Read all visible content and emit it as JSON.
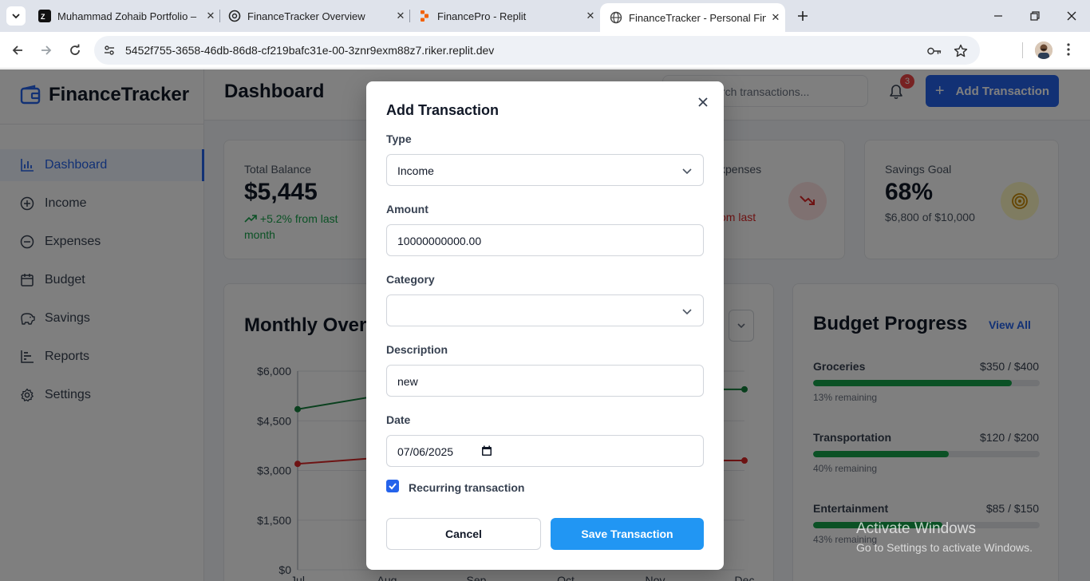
{
  "browser": {
    "tabs": [
      {
        "title": "Muhammad Zohaib Portfolio –",
        "favicon": "zohaib-logo-icon"
      },
      {
        "title": "FinanceTracker Overview",
        "favicon": "openai-icon"
      },
      {
        "title": "FinancePro - Replit",
        "favicon": "replit-icon"
      },
      {
        "title": "FinanceTracker - Personal Finan",
        "favicon": "globe-icon"
      }
    ],
    "url": "5452f755-3658-46db-86d8-cf219bafc31e-00-3znr9exm88z7.riker.replit.dev"
  },
  "app": {
    "name": "FinanceTracker",
    "page_title": "Dashboard",
    "search_placeholder": "Search transactions...",
    "notification_count": "3",
    "add_transaction_label": "Add Transaction",
    "nav": [
      {
        "label": "Dashboard",
        "icon": "bar-chart-icon"
      },
      {
        "label": "Income",
        "icon": "plus-circle-icon"
      },
      {
        "label": "Expenses",
        "icon": "minus-circle-icon"
      },
      {
        "label": "Budget",
        "icon": "calendar-icon"
      },
      {
        "label": "Savings",
        "icon": "piggy-bank-icon"
      },
      {
        "label": "Reports",
        "icon": "chart-icon"
      },
      {
        "label": "Settings",
        "icon": "gear-icon"
      }
    ],
    "stats": {
      "balance": {
        "label": "Total Balance",
        "value": "$5,445",
        "sub": "+5.2% from last month"
      },
      "expenses": {
        "label": "xpenses",
        "sub": "om last"
      },
      "savings": {
        "label": "Savings Goal",
        "value": "68%",
        "sub": "$6,800 of $10,000"
      }
    },
    "monthly": {
      "title": "Monthly Overv"
    },
    "chart_data": {
      "type": "line",
      "title": "Monthly Overview",
      "categories": [
        "Jul",
        "Aug",
        "Sep",
        "Oct",
        "Nov",
        "Dec"
      ],
      "y_ticks": [
        "$6,000",
        "$4,500",
        "$3,000",
        "$1,500",
        "$0"
      ],
      "ylim": [
        0,
        6000
      ],
      "series": [
        {
          "color": "#15803d",
          "values": [
            4850,
            5300,
            null,
            null,
            5450,
            5450
          ]
        },
        {
          "color": "#dc2626",
          "values": [
            3200,
            3400,
            null,
            null,
            3300,
            3300
          ]
        }
      ]
    },
    "budget": {
      "title": "Budget Progress",
      "view_all": "View All",
      "items": [
        {
          "name": "Groceries",
          "amount": "$350 / $400",
          "remaining": "13% remaining",
          "fill": 0.875
        },
        {
          "name": "Transportation",
          "amount": "$120 / $200",
          "remaining": "40% remaining",
          "fill": 0.6
        },
        {
          "name": "Entertainment",
          "amount": "$85 / $150",
          "remaining": "43% remaining",
          "fill": 0.57
        }
      ]
    }
  },
  "modal": {
    "title": "Add Transaction",
    "type_label": "Type",
    "type_value": "Income",
    "amount_label": "Amount",
    "amount_value": "10000000000.00",
    "category_label": "Category",
    "category_value": "",
    "description_label": "Description",
    "description_value": "new",
    "date_label": "Date",
    "date_value": "07/06/2025",
    "recurring_label": "Recurring transaction",
    "recurring_checked": true,
    "cancel_label": "Cancel",
    "save_label": "Save Transaction"
  },
  "watermark": {
    "line1": "Activate Windows",
    "line2": "Go to Settings to activate Windows."
  }
}
